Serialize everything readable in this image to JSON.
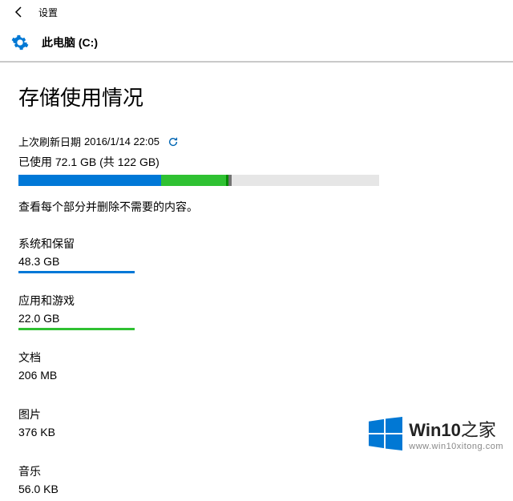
{
  "topbar": {
    "label": "设置"
  },
  "header": {
    "title": "此电脑 (C:)"
  },
  "page": {
    "title": "存储使用情况"
  },
  "refresh": {
    "prefix": "上次刷新日期",
    "datetime": "2016/1/14 22:05"
  },
  "usage": {
    "text": "已使用 72.1 GB (共 122 GB)",
    "used_gb": 72.1,
    "total_gb": 122,
    "segments": [
      {
        "name": "system",
        "color": "blue",
        "gb": 48.3
      },
      {
        "name": "apps",
        "color": "green",
        "gb": 22.0
      },
      {
        "name": "other-green",
        "color": "dgreen",
        "gb": 0.8
      },
      {
        "name": "other",
        "color": "grey",
        "gb": 1.0
      }
    ]
  },
  "description": "查看每个部分并删除不需要的内容。",
  "categories": [
    {
      "name": "系统和保留",
      "size": "48.3 GB",
      "bar": "blue"
    },
    {
      "name": "应用和游戏",
      "size": "22.0 GB",
      "bar": "green"
    },
    {
      "name": "文档",
      "size": "206 MB",
      "bar": ""
    },
    {
      "name": "图片",
      "size": "376 KB",
      "bar": ""
    },
    {
      "name": "音乐",
      "size": "56.0 KB",
      "bar": ""
    }
  ],
  "watermark": {
    "brand_bold": "Win10",
    "brand_rest": "之家",
    "url": "www.win10xitong.com"
  }
}
